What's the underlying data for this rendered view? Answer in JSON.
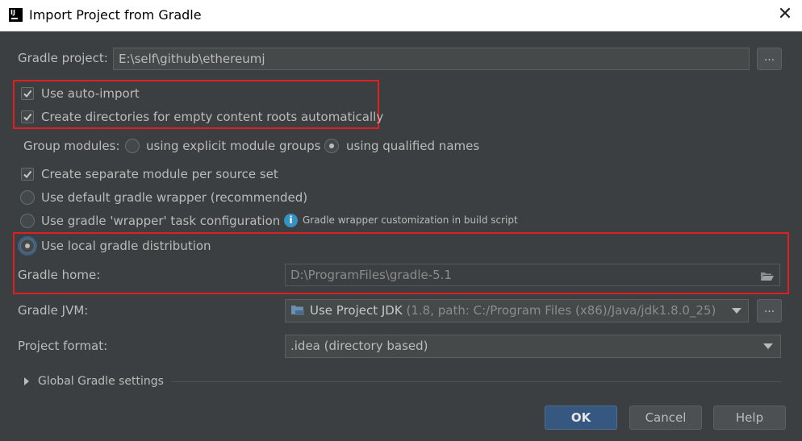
{
  "window": {
    "title": "Import Project from Gradle",
    "app_icon_text": "IJ"
  },
  "gradle_project": {
    "label": "Gradle project:",
    "value": "E:\\self\\github\\ethereumj",
    "browse_label": "..."
  },
  "options": {
    "auto_import": {
      "label": "Use auto-import",
      "checked": true
    },
    "create_dirs": {
      "label": "Create directories for empty content roots automatically",
      "checked": true
    }
  },
  "group_modules": {
    "label": "Group modules:",
    "explicit": {
      "label": "using explicit module groups",
      "selected": false
    },
    "qualified": {
      "label": "using qualified names",
      "selected": true
    }
  },
  "separate_module": {
    "label": "Create separate module per source set",
    "checked": true
  },
  "distribution": {
    "default_wrapper": {
      "label": "Use default gradle wrapper (recommended)",
      "selected": false
    },
    "wrapper_task": {
      "label": "Use gradle 'wrapper' task configuration",
      "selected": false
    },
    "wrapper_hint": "Gradle wrapper customization in build script",
    "local": {
      "label": "Use local gradle distribution",
      "selected": true
    }
  },
  "gradle_home": {
    "label": "Gradle home:",
    "value": "D:\\ProgramFiles\\gradle-5.1"
  },
  "gradle_jvm": {
    "label": "Gradle JVM:",
    "value": "Use Project JDK",
    "detail": "(1.8, path: C:/Program Files (x86)/Java/jdk1.8.0_25)",
    "browse_label": "..."
  },
  "project_format": {
    "label": "Project format:",
    "value": ".idea (directory based)"
  },
  "global_settings": {
    "label": "Global Gradle settings"
  },
  "buttons": {
    "ok": "OK",
    "cancel": "Cancel",
    "help": "Help"
  },
  "colors": {
    "background": "#3c3f41",
    "highlight_box": "#e02020",
    "primary_button": "#365880",
    "info_icon": "#3592c4"
  }
}
